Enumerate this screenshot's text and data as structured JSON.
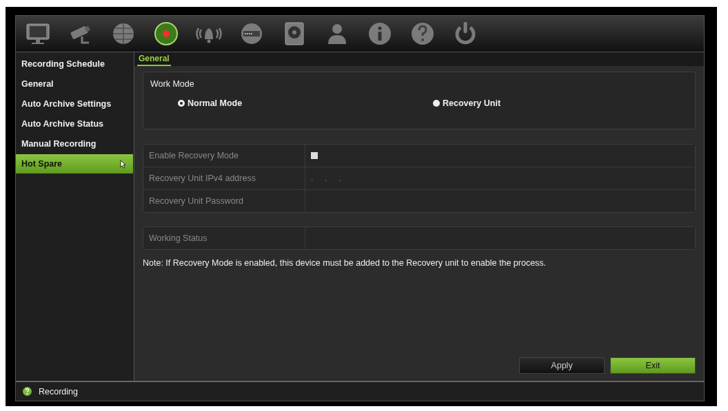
{
  "toolbar": [
    {
      "kind": "monitor",
      "selected": false
    },
    {
      "kind": "camera",
      "selected": false
    },
    {
      "kind": "globe",
      "selected": false
    },
    {
      "kind": "record",
      "selected": true
    },
    {
      "kind": "bell",
      "selected": false
    },
    {
      "kind": "dial",
      "selected": false
    },
    {
      "kind": "disk",
      "selected": false
    },
    {
      "kind": "user",
      "selected": false
    },
    {
      "kind": "info",
      "selected": false
    },
    {
      "kind": "help",
      "selected": false
    },
    {
      "kind": "power",
      "selected": false
    }
  ],
  "sidebar": {
    "items": [
      {
        "label": "Recording Schedule",
        "selected": false
      },
      {
        "label": "General",
        "selected": false
      },
      {
        "label": "Auto Archive Settings",
        "selected": false
      },
      {
        "label": "Auto Archive Status",
        "selected": false
      },
      {
        "label": "Manual Recording",
        "selected": false
      },
      {
        "label": "Hot Spare",
        "selected": true
      }
    ]
  },
  "tabs": [
    {
      "label": "General",
      "selected": true
    }
  ],
  "work_mode": {
    "title": "Work Mode",
    "options": [
      {
        "label": "Normal Mode",
        "selected": true
      },
      {
        "label": "Recovery Unit",
        "selected": false
      }
    ]
  },
  "settings": [
    {
      "kind": "checkbox",
      "label": "Enable Recovery Mode",
      "checked": false
    },
    {
      "kind": "ip",
      "label": "Recovery Unit IPv4 address",
      "value": ".     .     ."
    },
    {
      "kind": "password",
      "label": "Recovery Unit Password"
    }
  ],
  "status_row": {
    "label": "Working Status"
  },
  "note": "Note: If Recovery Mode is enabled, this device must be added to the Recovery unit to enable the process.",
  "buttons": [
    {
      "kind": "secondary",
      "label": "Apply"
    },
    {
      "kind": "primary",
      "label": "Exit"
    }
  ],
  "status_bar": {
    "text": "Recording"
  }
}
